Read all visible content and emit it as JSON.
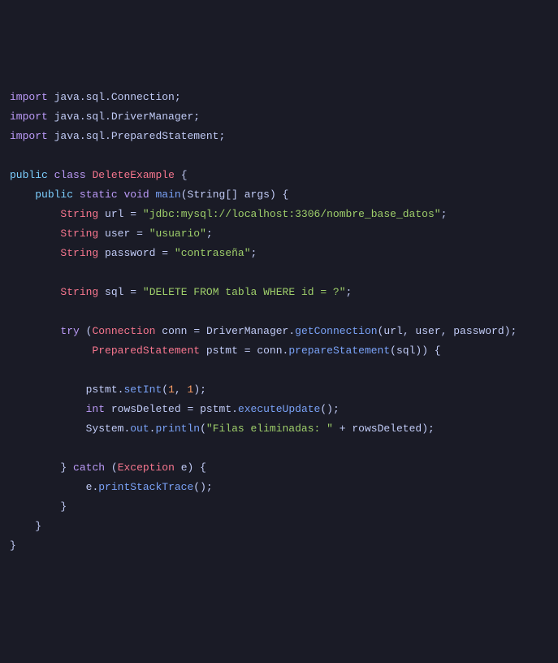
{
  "code": {
    "imports": [
      "java.sql.Connection",
      "java.sql.DriverManager",
      "java.sql.PreparedStatement"
    ],
    "kw_import": "import",
    "kw_public": "public",
    "kw_class": "class",
    "kw_static": "static",
    "kw_void": "void",
    "kw_try": "try",
    "kw_catch": "catch",
    "kw_int": "int",
    "classname": "DeleteExample",
    "main_method": "main",
    "main_params": "String[] args",
    "type_string": "String",
    "type_connection": "Connection",
    "type_prepared": "PreparedStatement",
    "type_exception": "Exception",
    "var_url": "url",
    "var_user": "user",
    "var_password": "password",
    "var_sql": "sql",
    "var_conn": "conn",
    "var_pstmt": "pstmt",
    "var_rows": "rowsDeleted",
    "var_e": "e",
    "str_url": "\"jdbc:mysql://localhost:3306/nombre_base_datos\"",
    "str_user": "\"usuario\"",
    "str_password": "\"contraseña\"",
    "str_sql": "\"DELETE FROM tabla WHERE id = ?\"",
    "str_output": "\"Filas eliminadas: \"",
    "drivermanager": "DriverManager",
    "getconnection": "getConnection",
    "preparestmt": "prepareStatement",
    "setint": "setInt",
    "setint_arg1": "1",
    "setint_arg2": "1",
    "executeupdate": "executeUpdate",
    "system": "System",
    "out": "out",
    "println": "println",
    "printstack": "printStackTrace"
  }
}
